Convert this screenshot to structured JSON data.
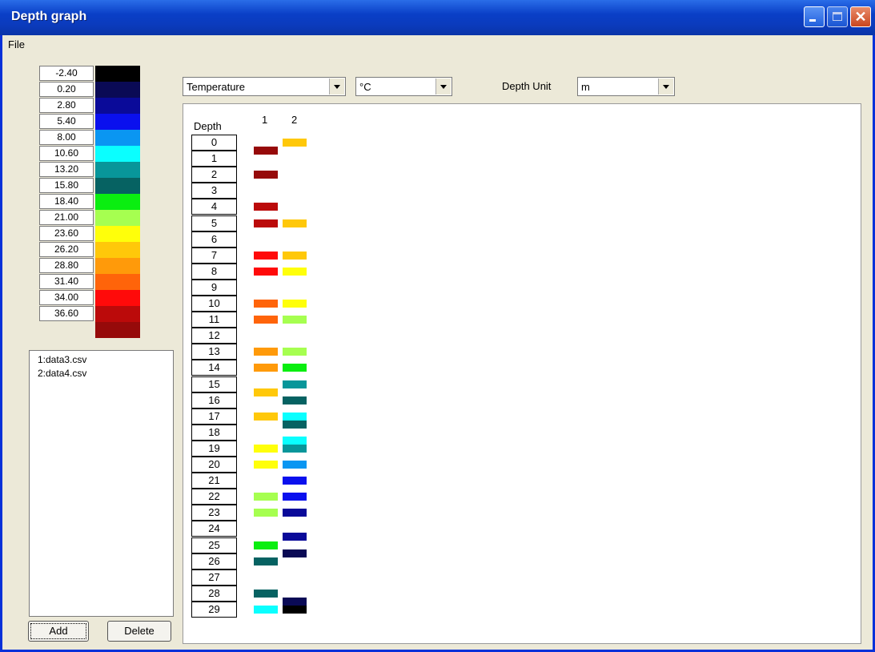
{
  "window": {
    "title": "Depth graph"
  },
  "menu": {
    "file": "File"
  },
  "legend": [
    {
      "value": "-2.40",
      "color": "#000000"
    },
    {
      "value": "0.20",
      "color": "#0a0a55"
    },
    {
      "value": "2.80",
      "color": "#0a0a99"
    },
    {
      "value": "5.40",
      "color": "#0a10ee"
    },
    {
      "value": "8.00",
      "color": "#0a96f2"
    },
    {
      "value": "10.60",
      "color": "#0affff"
    },
    {
      "value": "13.20",
      "color": "#08969a"
    },
    {
      "value": "15.80",
      "color": "#066262"
    },
    {
      "value": "18.40",
      "color": "#0aee10"
    },
    {
      "value": "21.00",
      "color": "#a6ff50"
    },
    {
      "value": "23.60",
      "color": "#ffff0a"
    },
    {
      "value": "26.20",
      "color": "#ffc80a"
    },
    {
      "value": "28.80",
      "color": "#ff9a0a"
    },
    {
      "value": "31.40",
      "color": "#ff640a"
    },
    {
      "value": "34.00",
      "color": "#ff0a0a"
    },
    {
      "value": "36.60",
      "color": "#bb0a0a"
    },
    {
      "value": "",
      "color": "#960a0a"
    }
  ],
  "files": [
    "1:data3.csv",
    "2:data4.csv"
  ],
  "buttons": {
    "add": "Add",
    "delete": "Delete"
  },
  "controls": {
    "parameter": "Temperature",
    "unit": "°C",
    "depth_unit_label": "Depth Unit",
    "depth_unit": "m"
  },
  "graph": {
    "depth_header": "Depth",
    "depths": [
      "0",
      "1",
      "2",
      "3",
      "4",
      "5",
      "6",
      "7",
      "8",
      "9",
      "10",
      "11",
      "12",
      "13",
      "14",
      "15",
      "16",
      "17",
      "18",
      "19",
      "20",
      "21",
      "22",
      "23",
      "24",
      "25",
      "26",
      "27",
      "28",
      "29"
    ]
  },
  "chart_data": {
    "type": "table",
    "columns": [
      "1",
      "2"
    ],
    "series": [
      {
        "name": "1",
        "points": [
          {
            "depth": 0.5,
            "color": "#960a0a"
          },
          {
            "depth": 2,
            "color": "#960a0a"
          },
          {
            "depth": 4,
            "color": "#bb0a0a"
          },
          {
            "depth": 5,
            "color": "#bb0a0a"
          },
          {
            "depth": 7,
            "color": "#ff0a0a"
          },
          {
            "depth": 8,
            "color": "#ff0a0a"
          },
          {
            "depth": 10,
            "color": "#ff640a"
          },
          {
            "depth": 11,
            "color": "#ff640a"
          },
          {
            "depth": 13,
            "color": "#ff9a0a"
          },
          {
            "depth": 14,
            "color": "#ff9a0a"
          },
          {
            "depth": 15.5,
            "color": "#ffc80a"
          },
          {
            "depth": 17,
            "color": "#ffc80a"
          },
          {
            "depth": 19,
            "color": "#ffff0a"
          },
          {
            "depth": 20,
            "color": "#ffff0a"
          },
          {
            "depth": 22,
            "color": "#a6ff50"
          },
          {
            "depth": 23,
            "color": "#a6ff50"
          },
          {
            "depth": 25,
            "color": "#0aee10"
          },
          {
            "depth": 26,
            "color": "#066262"
          },
          {
            "depth": 28,
            "color": "#066262"
          },
          {
            "depth": 29,
            "color": "#0affff"
          }
        ]
      },
      {
        "name": "2",
        "points": [
          {
            "depth": 0,
            "color": "#ffc80a"
          },
          {
            "depth": 5,
            "color": "#ffc80a"
          },
          {
            "depth": 7,
            "color": "#ffc80a"
          },
          {
            "depth": 8,
            "color": "#ffff0a"
          },
          {
            "depth": 10,
            "color": "#ffff0a"
          },
          {
            "depth": 11,
            "color": "#a6ff50"
          },
          {
            "depth": 13,
            "color": "#a6ff50"
          },
          {
            "depth": 14,
            "color": "#0aee10"
          },
          {
            "depth": 15,
            "color": "#08969a"
          },
          {
            "depth": 16,
            "color": "#066262"
          },
          {
            "depth": 17,
            "color": "#0affff"
          },
          {
            "depth": 17.5,
            "color": "#066262"
          },
          {
            "depth": 18.5,
            "color": "#0affff"
          },
          {
            "depth": 19,
            "color": "#08969a"
          },
          {
            "depth": 20,
            "color": "#0a96f2"
          },
          {
            "depth": 21,
            "color": "#0a10ee"
          },
          {
            "depth": 22,
            "color": "#0a10ee"
          },
          {
            "depth": 23,
            "color": "#0a0a99"
          },
          {
            "depth": 24.5,
            "color": "#0a0a99"
          },
          {
            "depth": 25.5,
            "color": "#0a0a55"
          },
          {
            "depth": 28.5,
            "color": "#0a0a55"
          },
          {
            "depth": 29,
            "color": "#000000"
          }
        ]
      }
    ]
  }
}
